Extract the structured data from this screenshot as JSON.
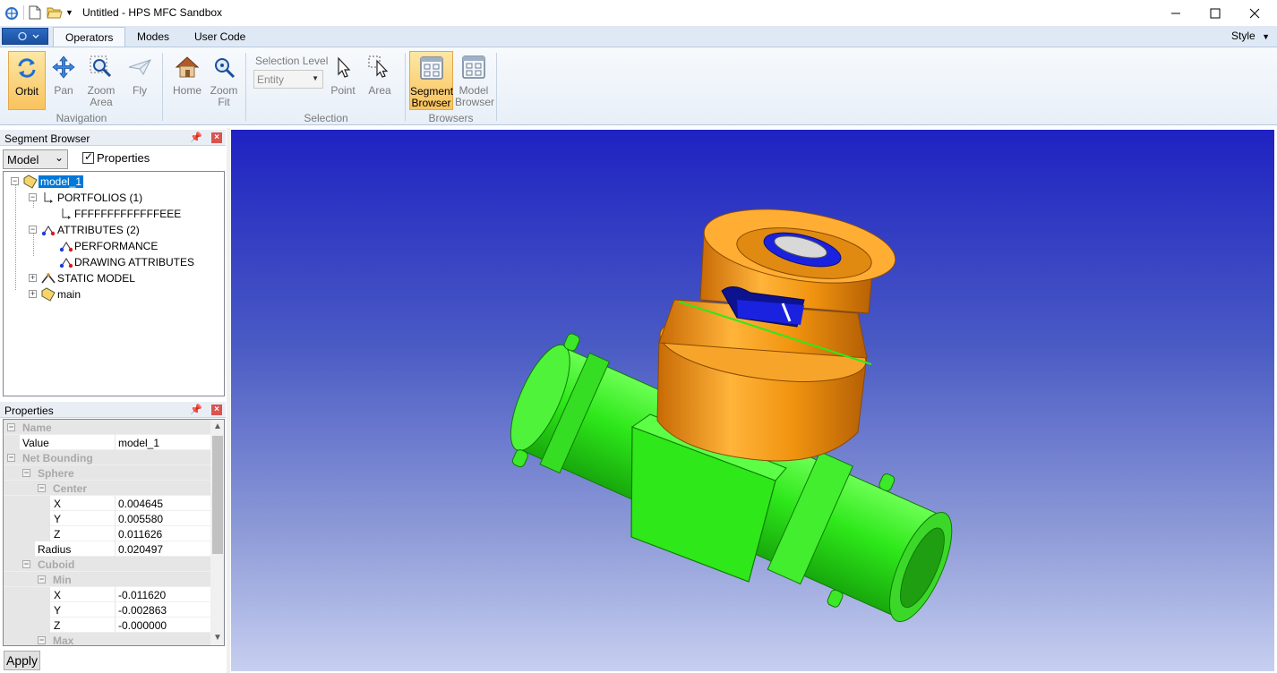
{
  "window": {
    "title": "Untitled - HPS MFC Sandbox",
    "controls": [
      "minimize",
      "maximize",
      "close"
    ]
  },
  "quick_access": [
    "app-icon",
    "new-file-icon",
    "open-folder-icon",
    "dropdown-arrow-icon"
  ],
  "tabs": [
    {
      "label": "Operators",
      "active": true
    },
    {
      "label": "Modes",
      "active": false
    },
    {
      "label": "User Code",
      "active": false
    }
  ],
  "style_menu": "Style",
  "ribbon": {
    "navigation": {
      "label": "Navigation",
      "buttons": [
        {
          "label": "Orbit",
          "icon": "orbit-icon",
          "selected": true
        },
        {
          "label": "Pan",
          "icon": "pan-icon"
        },
        {
          "label": "Zoom Area",
          "icon": "zoom-area-icon"
        },
        {
          "label": "Fly",
          "icon": "fly-icon"
        }
      ]
    },
    "view": {
      "buttons": [
        {
          "label": "Home",
          "icon": "home-icon"
        },
        {
          "label": "Zoom Fit",
          "icon": "zoom-fit-icon"
        }
      ]
    },
    "selection": {
      "label": "Selection",
      "level_label": "Selection Level",
      "level_value": "Entity",
      "buttons": [
        {
          "label": "Point",
          "icon": "point-select-icon"
        },
        {
          "label": "Area",
          "icon": "area-select-icon"
        }
      ]
    },
    "browsers": {
      "label": "Browsers",
      "buttons": [
        {
          "label": "Segment Browser",
          "icon": "segment-browser-icon",
          "selected": true
        },
        {
          "label": "Model Browser",
          "icon": "model-browser-icon"
        }
      ]
    }
  },
  "segment_browser": {
    "title": "Segment Browser",
    "combo_value": "Model",
    "properties_checkbox": "Properties",
    "properties_checked": true,
    "tree": [
      {
        "label": "model_1",
        "icon": "folder-icon",
        "selected": true
      },
      {
        "label": "PORTFOLIOS (1)",
        "icon": "portfolio-icon"
      },
      {
        "label": "FFFFFFFFFFFFFEEE",
        "icon": "portfolio-icon"
      },
      {
        "label": "ATTRIBUTES (2)",
        "icon": "attributes-icon"
      },
      {
        "label": "PERFORMANCE",
        "icon": "attributes-icon"
      },
      {
        "label": "DRAWING ATTRIBUTES",
        "icon": "attributes-icon"
      },
      {
        "label": "STATIC MODEL",
        "icon": "static-model-icon"
      },
      {
        "label": "main",
        "icon": "folder-icon"
      }
    ]
  },
  "properties": {
    "title": "Properties",
    "rows": [
      {
        "name": "Name",
        "category": true
      },
      {
        "name": "Value",
        "value": "model_1"
      },
      {
        "name": "Net Bounding",
        "category": true
      },
      {
        "name": "Sphere",
        "category": true
      },
      {
        "name": "Center",
        "category": true
      },
      {
        "name": "X",
        "value": "0.004645"
      },
      {
        "name": "Y",
        "value": "0.005580"
      },
      {
        "name": "Z",
        "value": "0.011626"
      },
      {
        "name": "Radius",
        "value": "0.020497"
      },
      {
        "name": "Cuboid",
        "category": true
      },
      {
        "name": "Min",
        "category": true
      },
      {
        "name": "X",
        "value": "-0.011620"
      },
      {
        "name": "Y",
        "value": "-0.002863"
      },
      {
        "name": "Z",
        "value": "-0.000000"
      },
      {
        "name": "Max",
        "category": true
      }
    ],
    "apply_button": "Apply"
  },
  "viewport": {
    "content": "bnc-connector-3d-model",
    "colors": {
      "background_top": "#1e22c2",
      "background_bottom": "#c7cff0",
      "body": "#2ee81a",
      "cap": "#f0930f",
      "insert": "#1a22e0"
    }
  }
}
